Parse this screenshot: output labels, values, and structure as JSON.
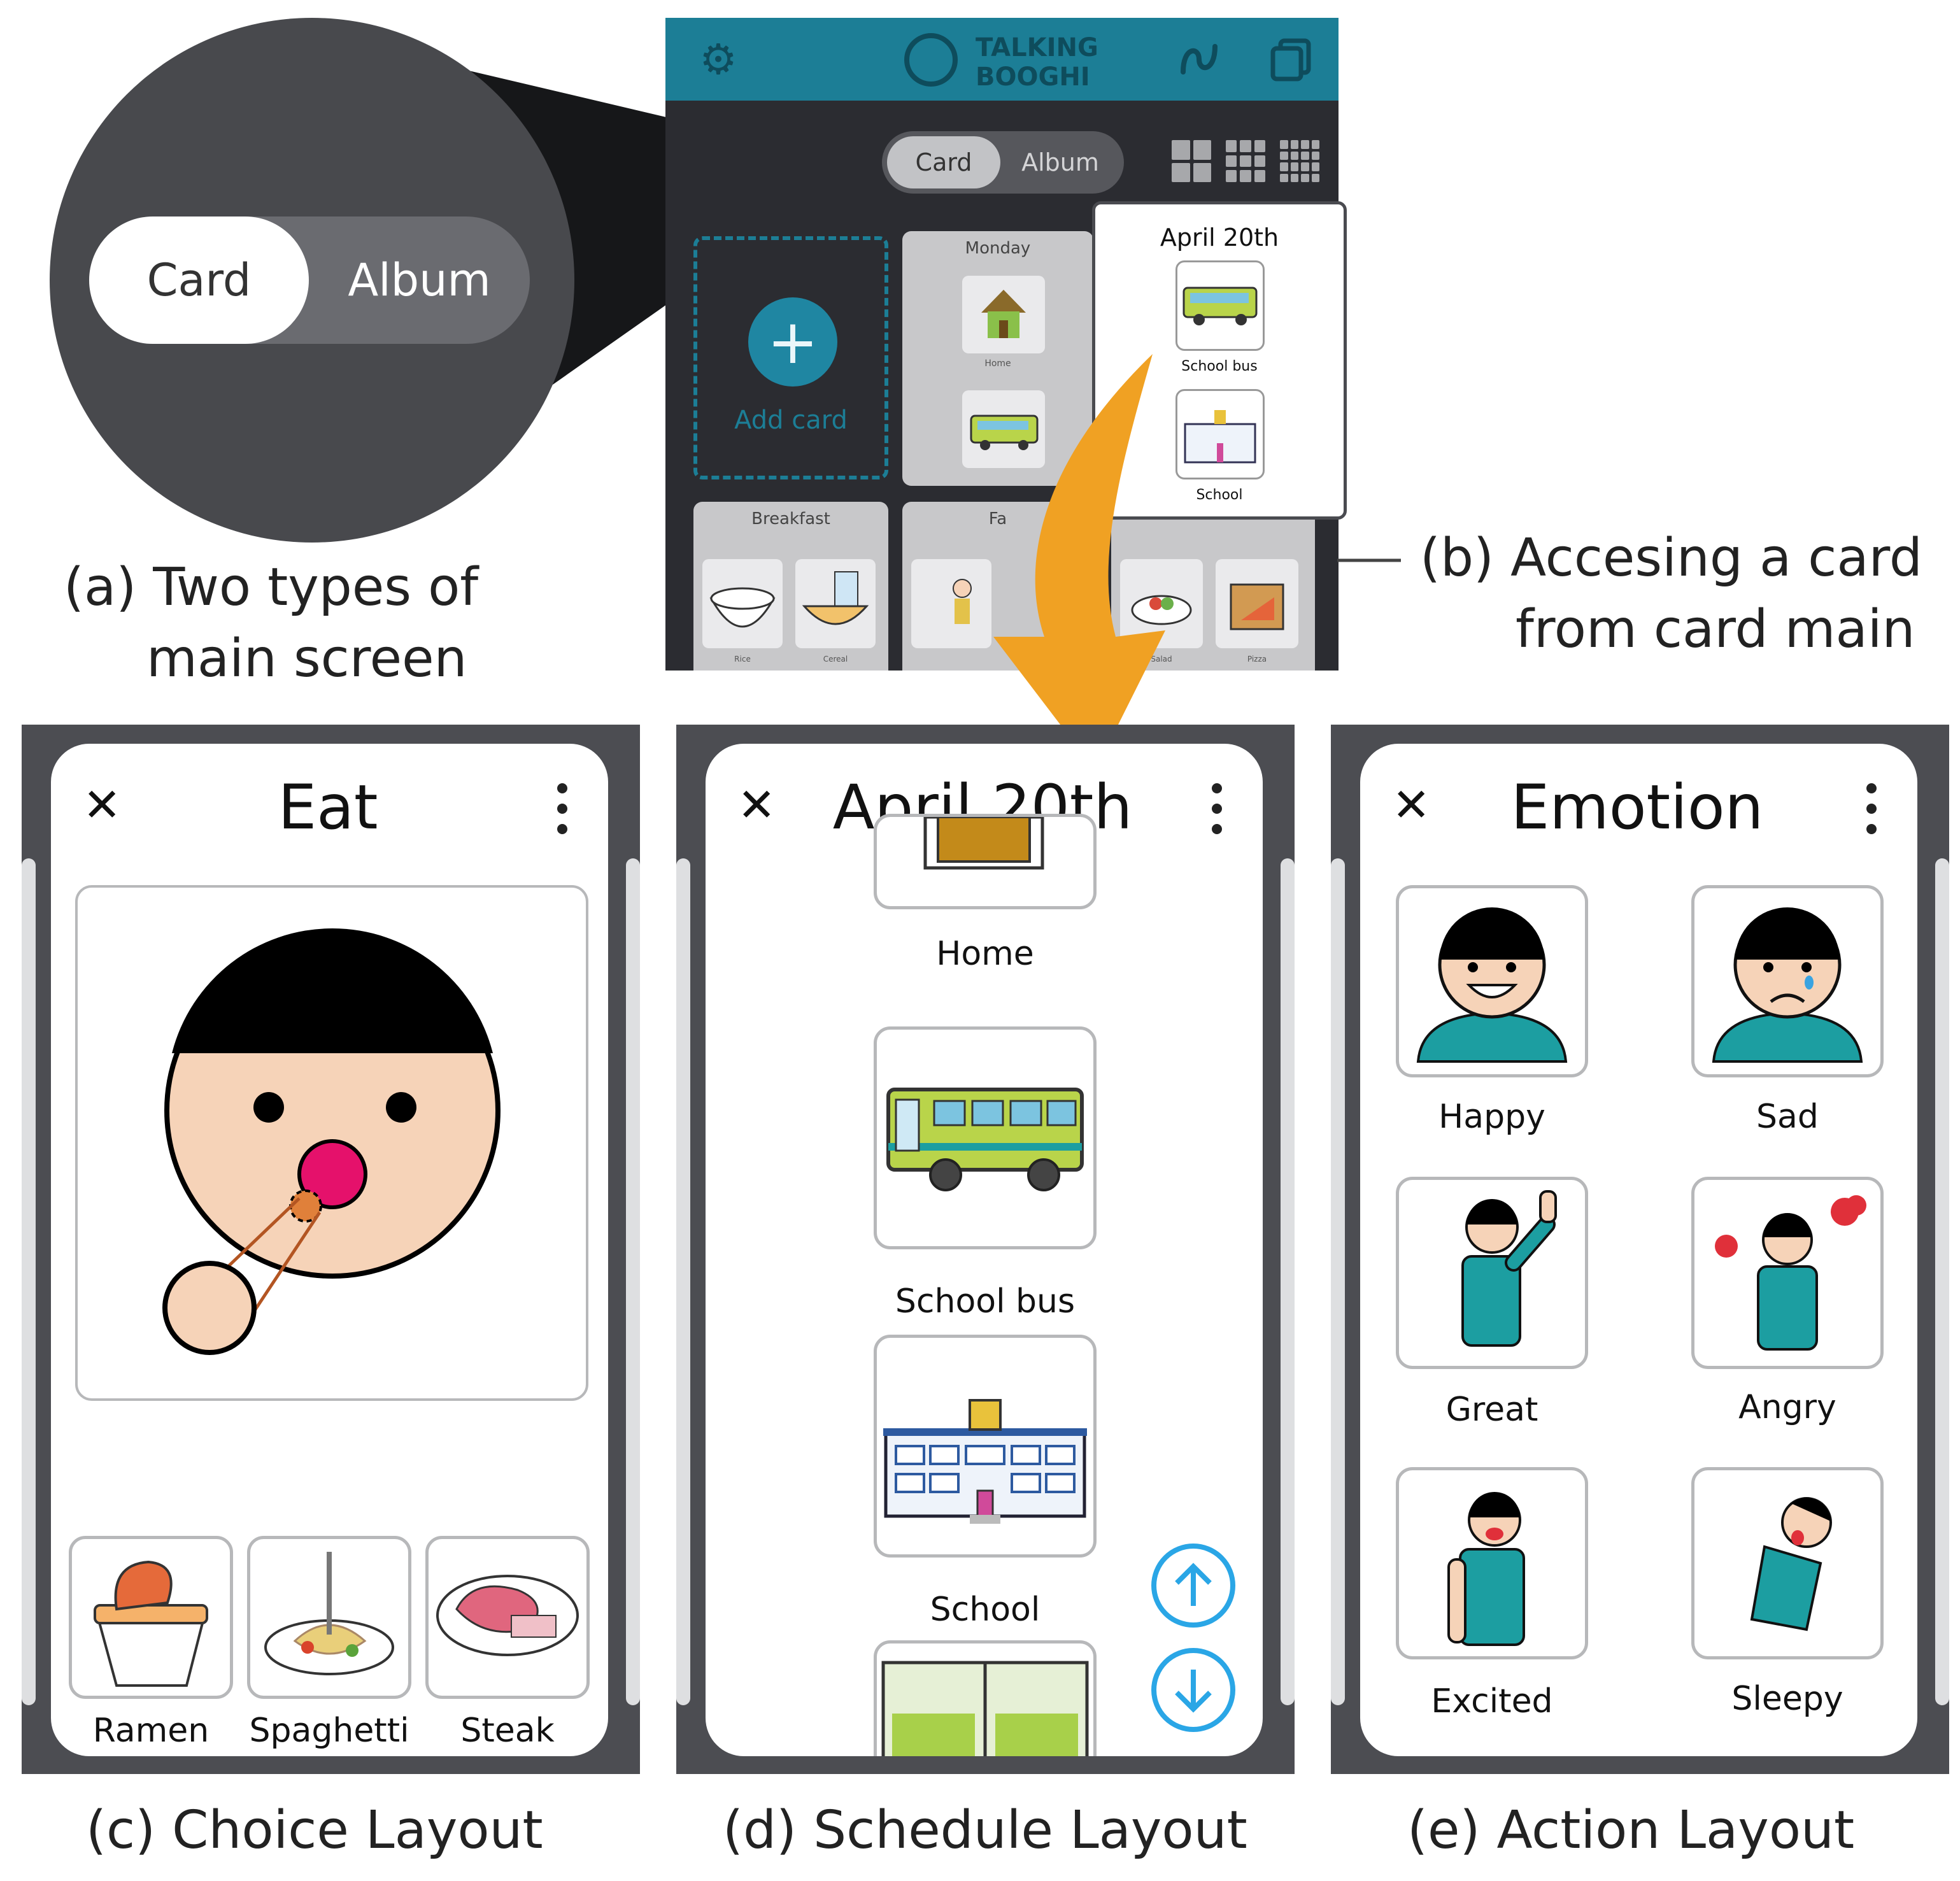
{
  "panel_a": {
    "toggle": {
      "card": "Card",
      "album": "Album"
    },
    "caption_line1": "(a) Two types of",
    "caption_line2": "main screen"
  },
  "panel_b": {
    "app": {
      "logo_line1": "TALKING",
      "logo_line2": "BOOGHI",
      "icons": {
        "settings": "gear-icon",
        "logo": "booghi-logo-icon",
        "undo": "loop-arrow-icon",
        "copy": "copy-icon"
      },
      "toggle": {
        "card": "Card",
        "album": "Album"
      },
      "add_card_label": "Add card",
      "cards": {
        "monday": "Monday",
        "home_small": "Home",
        "breakfast": "Breakfast",
        "breakfast_item1": "Rice",
        "breakfast_item2": "Cereal",
        "family_partial": "Fa",
        "item_salad": "Salad",
        "item_pizza": "Pizza"
      }
    },
    "popup": {
      "title": "April 20th",
      "items": [
        "School bus",
        "School"
      ]
    },
    "caption_line1": "(b) Accesing a card",
    "caption_line2": "from card main",
    "accent_color": "#f0a123"
  },
  "panel_c": {
    "title": "Eat",
    "choices": [
      "Ramen",
      "Spaghetti",
      "Steak"
    ],
    "caption": "(c) Choice Layout"
  },
  "panel_d": {
    "title": "April 20th",
    "items": [
      "Home",
      "School bus",
      "School"
    ],
    "caption": "(d) Schedule Layout"
  },
  "panel_e": {
    "title": "Emotion",
    "actions": [
      "Happy",
      "Sad",
      "Great",
      "Angry",
      "Excited",
      "Sleepy"
    ],
    "caption": "(e) Action Layout"
  },
  "colors": {
    "app_bar": "#1c7e96",
    "frame": "#4c4d52",
    "scroll_blue": "#2aa6e6",
    "arrow_orange": "#f0a123",
    "skin": "#f6d3b8",
    "shirt": "#1c9ea1"
  }
}
